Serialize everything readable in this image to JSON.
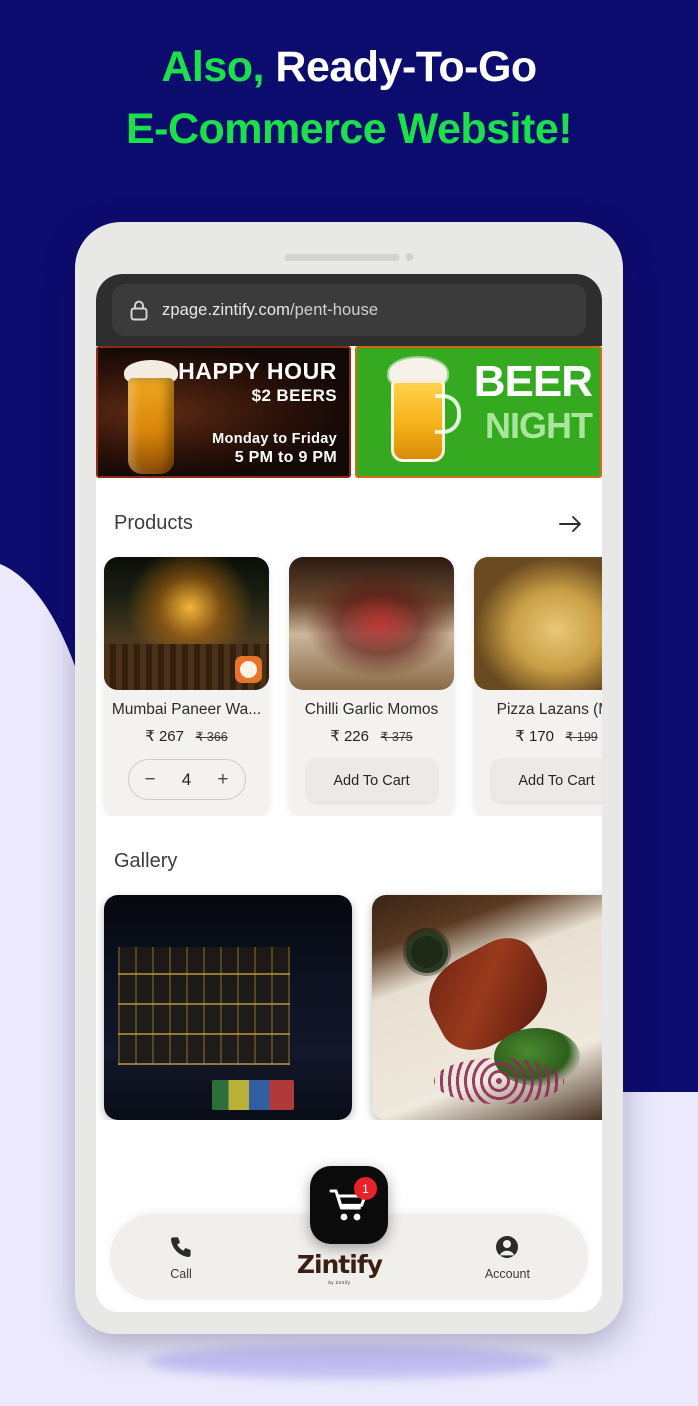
{
  "headline": {
    "line1_green": "Also,",
    "line1_white": "Ready-To-Go",
    "line2_green": "E-Commerce Website!"
  },
  "colors": {
    "bg_navy": "#0c0b6e",
    "bg_lavender": "#ebe9fb",
    "accent_green": "#1ae04a",
    "badge_red": "#e8222a",
    "banner_green": "#35a920"
  },
  "browser": {
    "lock_icon": "lock-icon",
    "url_prefix": "zpage.zintify.com",
    "url_path": "/pent-house"
  },
  "banners": [
    {
      "id": "happy-hour",
      "title": "HAPPY HOUR",
      "subtitle": "$2 BEERS",
      "days": "Monday to Friday",
      "hours": "5 PM to 9 PM"
    },
    {
      "id": "beer-night",
      "line1": "BEER",
      "line2": "NIGHT"
    }
  ],
  "products_section": {
    "title": "Products",
    "arrow_icon": "arrow-right-icon",
    "items": [
      {
        "name": "Mumbai Paneer Wa...",
        "currency": "₹",
        "price": "267",
        "original_price": "₹ 366",
        "control": "stepper",
        "quantity": "4",
        "minus_label": "−",
        "plus_label": "+"
      },
      {
        "name": "Chilli Garlic Momos",
        "currency": "₹",
        "price": "226",
        "original_price": "₹ 375",
        "control": "button",
        "button_label": "Add To Cart"
      },
      {
        "name": "Pizza Lazans (M-",
        "currency": "₹",
        "price": "170",
        "original_price": "₹ 199",
        "control": "button",
        "button_label": "Add To Cart"
      }
    ]
  },
  "gallery_section": {
    "title": "Gallery",
    "items": [
      {
        "id": "bar-interior"
      },
      {
        "id": "kebab-plate"
      }
    ]
  },
  "bottom_nav": {
    "call": {
      "label": "Call",
      "icon": "phone-icon"
    },
    "brand": {
      "name": "Zintify",
      "subtext": "by Zintify"
    },
    "account": {
      "label": "Account",
      "icon": "account-icon"
    },
    "cart_fab": {
      "icon": "shopping-cart-icon",
      "badge": "1"
    }
  }
}
